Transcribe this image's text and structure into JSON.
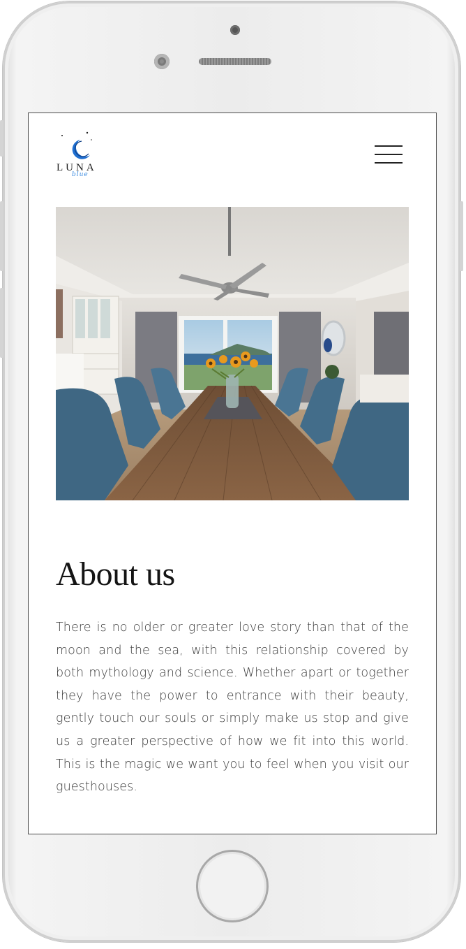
{
  "header": {
    "logo_text": "LUNA",
    "logo_subtext": "blue",
    "menu_icon": "hamburger-menu-icon"
  },
  "hero_image": {
    "alt": "Dining room with long wooden table, blue chairs, sunflowers and sea view"
  },
  "about": {
    "title": "About us",
    "body": "There is no older or greater love story than that of the moon and the sea, with this relationship covered by both mythology and science. Whether apart or together they have the power to entrance with their beauty, gently touch our souls or simply make us stop and give us a greater perspective of how we fit into this world. This is the magic we want you to feel when you visit our guesthouses."
  },
  "colors": {
    "brand_blue": "#1f6fd1",
    "text_dark": "#141414",
    "text_body": "#3a3a3a"
  }
}
